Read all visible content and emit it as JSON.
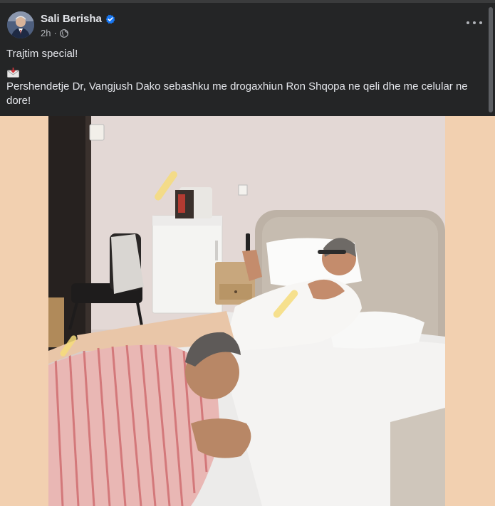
{
  "author": {
    "name": "Sali Berisha",
    "verified_icon": "verified-badge-icon",
    "avatar_icon": "profile-avatar"
  },
  "meta": {
    "time": "2h",
    "separator": "·",
    "audience_icon": "globe-icon"
  },
  "actions": {
    "more_icon": "more-options-icon"
  },
  "post": {
    "line1": "Trajtim special!",
    "emoji_icon": "envelope-with-arrow-icon",
    "body": "Pershendetje Dr, Vangjush Dako  sebashku me drogaxhiun Ron Shqopa ne qeli dhe me celular ne dore!"
  },
  "colors": {
    "background": "#242526",
    "text_primary": "#e4e6eb",
    "text_secondary": "#b0b3b8",
    "verified": "#1877f2",
    "photo_backdrop": "#f2d0b0"
  }
}
